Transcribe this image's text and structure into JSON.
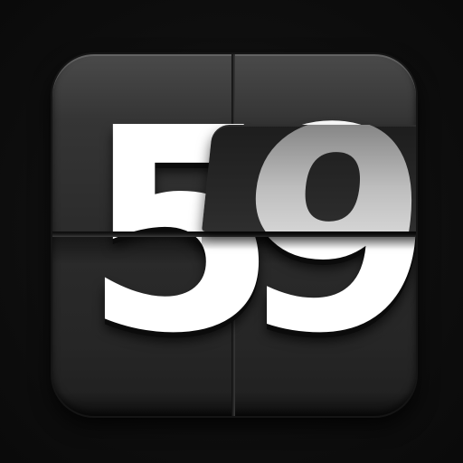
{
  "icon": {
    "name": "flip-clock-app-icon",
    "digits": {
      "left": "5",
      "right": "9",
      "flap": "9"
    },
    "colors": {
      "background": "#0d0d0d",
      "tile": "#2b2b2b",
      "digit": "#ffffff"
    }
  }
}
